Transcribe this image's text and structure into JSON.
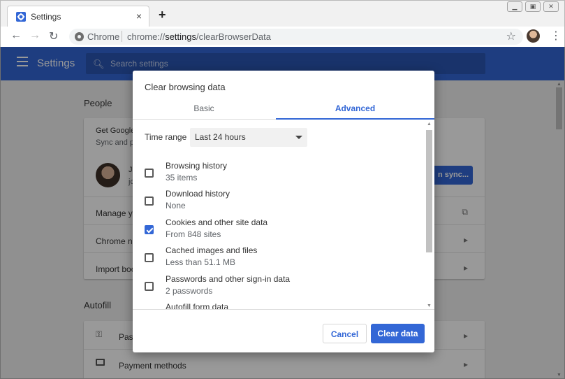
{
  "browser": {
    "tab_title": "Settings",
    "new_tab_glyph": "+",
    "close_glyph": "×",
    "omnibox_chip": "Chrome",
    "url_prefix": "chrome://",
    "url_path": "settings",
    "url_suffix": "/clearBrowserData",
    "icons": [
      "settings-gear-icon",
      "back-arrow-icon",
      "forward-arrow-icon",
      "reload-icon",
      "site-info-icon",
      "bookmark-star-icon",
      "profile-avatar-icon",
      "menu-dots-icon"
    ]
  },
  "settings": {
    "header_title": "Settings",
    "search_placeholder": "Search settings",
    "accent_color": "#3367d6",
    "people": {
      "title": "People",
      "sync_line1": "Get Google",
      "sync_line2": "Sync and p",
      "user_initial": "J",
      "user_email_start": "jo",
      "sync_button": "n sync...",
      "rows": [
        "Manage yo",
        "Chrome na",
        "Import boo"
      ]
    },
    "autofill": {
      "title": "Autofill",
      "rows": [
        "Pas",
        "Payment methods"
      ]
    }
  },
  "dialog": {
    "title": "Clear browsing data",
    "tabs": [
      {
        "label": "Basic",
        "selected": false
      },
      {
        "label": "Advanced",
        "selected": true
      }
    ],
    "time_range_label": "Time range",
    "time_range_value": "Last 24 hours",
    "items": [
      {
        "name": "Browsing history",
        "detail": "35 items",
        "checked": false
      },
      {
        "name": "Download history",
        "detail": "None",
        "checked": false
      },
      {
        "name": "Cookies and other site data",
        "detail": "From 848 sites",
        "checked": true
      },
      {
        "name": "Cached images and files",
        "detail": "Less than 51.1 MB",
        "checked": false
      },
      {
        "name": "Passwords and other sign-in data",
        "detail": "2 passwords",
        "checked": false
      },
      {
        "name": "Autofill form data",
        "detail": "",
        "checked": false
      }
    ],
    "cancel_label": "Cancel",
    "clear_label": "Clear data"
  }
}
